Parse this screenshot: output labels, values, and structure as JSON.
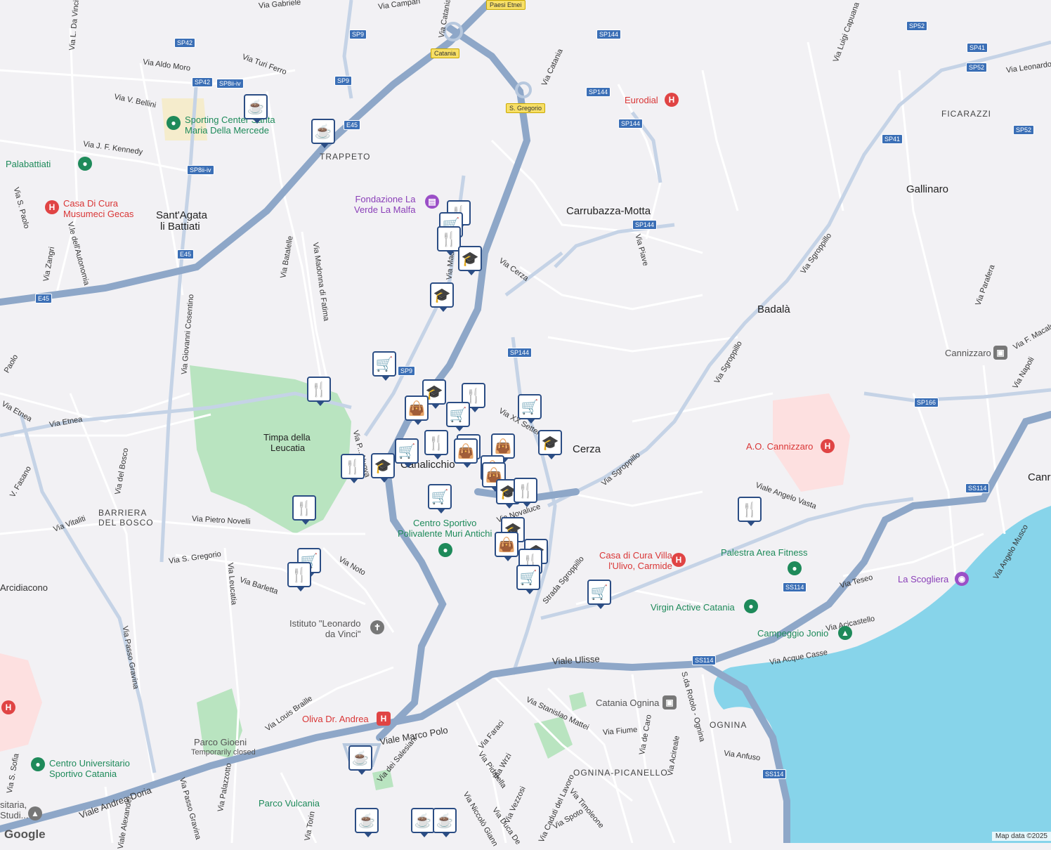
{
  "colors": {
    "background": "#f2f1f4",
    "sea": "#87d4ea",
    "park": "#b9e4c0",
    "hospital_area": "#fde0e0",
    "highway": "#8ea7c8",
    "marker_border": "#2b4d84"
  },
  "areas": [
    {
      "id": "trappeto",
      "text": "TRAPPETO",
      "kind": "dist"
    },
    {
      "id": "sant-agata",
      "text": "Sant'Agata",
      "kind": "area"
    },
    {
      "id": "li-battiati",
      "text": "li Battiati",
      "kind": "area"
    },
    {
      "id": "carrubazza",
      "text": "Carrubazza-Motta",
      "kind": "area"
    },
    {
      "id": "gallinaro",
      "text": "Gallinaro",
      "kind": "area"
    },
    {
      "id": "ficarazzi",
      "text": "FICARAZZI",
      "kind": "dist"
    },
    {
      "id": "badala",
      "text": "Badalà",
      "kind": "area"
    },
    {
      "id": "cerza",
      "text": "Cerza",
      "kind": "area"
    },
    {
      "id": "canalicchio",
      "text": "Canalicchio",
      "kind": "area"
    },
    {
      "id": "barriera",
      "text": "BARRIERA",
      "kind": "dist"
    },
    {
      "id": "del-bosco",
      "text": "DEL BOSCO",
      "kind": "dist"
    },
    {
      "id": "ognina",
      "text": "OGNINA",
      "kind": "dist"
    },
    {
      "id": "ognina-picanello",
      "text": "OGNINA-PICANELLO",
      "kind": "dist"
    },
    {
      "id": "timpa",
      "text": "Timpa della",
      "kind": "area-sm"
    },
    {
      "id": "leucatia",
      "text": "Leucatia",
      "kind": "area-sm"
    },
    {
      "id": "canr",
      "text": "Canr",
      "kind": "area"
    }
  ],
  "roads": [
    {
      "id": "via-aldo-moro",
      "text": "Via Aldo Moro"
    },
    {
      "id": "via-turi-ferro",
      "text": "Via Turi Ferro"
    },
    {
      "id": "via-v-bellini",
      "text": "Via V. Bellini"
    },
    {
      "id": "via-j-f-kennedy",
      "text": "Via J. F. Kennedy"
    },
    {
      "id": "via-l-da-vinci",
      "text": "Via L. Da Vinci"
    },
    {
      "id": "via-catania-1",
      "text": "Via Catania"
    },
    {
      "id": "via-catania-2",
      "text": "Via Catania"
    },
    {
      "id": "via-gabriele",
      "text": "Via Gabriele"
    },
    {
      "id": "via-campanella",
      "text": "Via Campan"
    },
    {
      "id": "via-cerza",
      "text": "Via Cerza"
    },
    {
      "id": "via-piave",
      "text": "Via Piave"
    },
    {
      "id": "via-sgroppillo-1",
      "text": "Via Sgroppillo"
    },
    {
      "id": "via-sgroppillo-2",
      "text": "Via Sgroppillo"
    },
    {
      "id": "via-sgroppillo-3",
      "text": "Via Sgroppillo"
    },
    {
      "id": "strada-sgroppillo",
      "text": "Strada Sgroppillo"
    },
    {
      "id": "via-luigi-capuana",
      "text": "Via Luigi Capuana"
    },
    {
      "id": "via-leonardo",
      "text": "Via Leonardo"
    },
    {
      "id": "via-parafera",
      "text": "Via Parafera"
    },
    {
      "id": "via-f-macaluso",
      "text": "Via F. Macaluso"
    },
    {
      "id": "via-napoli",
      "text": "Via Napoli"
    },
    {
      "id": "via-batalelle",
      "text": "Via Batalelle"
    },
    {
      "id": "via-madonna-fatima",
      "text": "Via Madonna di Fatima"
    },
    {
      "id": "via-giovanni-cosentino",
      "text": "Via Giovanni Cosentino"
    },
    {
      "id": "via-s-paolo",
      "text": "Via S. Paolo"
    },
    {
      "id": "via-paolo",
      "text": "Paolo"
    },
    {
      "id": "via-zangri",
      "text": "Via Zangri"
    },
    {
      "id": "via-autonomia",
      "text": "V.le dell'Autonomia"
    },
    {
      "id": "via-etnea-1",
      "text": "Via Etnea"
    },
    {
      "id": "via-etnea-2",
      "text": "Via Etnea"
    },
    {
      "id": "v-fasano",
      "text": "V. Fasano"
    },
    {
      "id": "via-del-bosco",
      "text": "Via del Bosco"
    },
    {
      "id": "via-vitaliti",
      "text": "Via Vitaliti"
    },
    {
      "id": "via-pietro-novelli",
      "text": "Via Pietro Novelli"
    },
    {
      "id": "via-s-gregorio",
      "text": "Via S. Gregorio"
    },
    {
      "id": "via-leucatia",
      "text": "Via Leucatia"
    },
    {
      "id": "via-barletta",
      "text": "Via Barletta"
    },
    {
      "id": "via-noto",
      "text": "Via Noto"
    },
    {
      "id": "via-xx-settembre",
      "text": "Via XX Settembre"
    },
    {
      "id": "via-novaluce",
      "text": "Via Novaluce"
    },
    {
      "id": "viale-angelo-vasta",
      "text": "Viale Angelo Vasta"
    },
    {
      "id": "via-teseo",
      "text": "Via Teseo"
    },
    {
      "id": "via-acicastello",
      "text": "Via Acicastello"
    },
    {
      "id": "via-acque-casse",
      "text": "Via Acque Casse"
    },
    {
      "id": "via-angelo-musco",
      "text": "Via Angelo Musco"
    },
    {
      "id": "viale-ulisse",
      "text": "Viale Ulisse"
    },
    {
      "id": "via-passo-gravina",
      "text": "Via Passo Gravina"
    },
    {
      "id": "via-louis-braille",
      "text": "Via Louis Braille"
    },
    {
      "id": "viale-marco-polo",
      "text": "Viale Marco Polo"
    },
    {
      "id": "via-stanislao-mattei",
      "text": "Via Stanislao Mattei"
    },
    {
      "id": "via-fiume",
      "text": "Via Fiume"
    },
    {
      "id": "via-de-caro",
      "text": "Via de Caro"
    },
    {
      "id": "via-rotolo",
      "text": "S.da Rotolo - Ognina"
    },
    {
      "id": "via-acireale",
      "text": "Via Acireale"
    },
    {
      "id": "via-anfuso",
      "text": "Via Anfuso"
    },
    {
      "id": "via-faraci",
      "text": "Via Faraci"
    },
    {
      "id": "via-wrzi",
      "text": "Via Wrzi"
    },
    {
      "id": "via-pidatella",
      "text": "Via Pidatella"
    },
    {
      "id": "via-salesiani",
      "text": "Via dei Salesiani"
    },
    {
      "id": "via-vezzosi",
      "text": "Via Vezzosi"
    },
    {
      "id": "via-caduti-lavoro",
      "text": "Via Caduti del Lavoro"
    },
    {
      "id": "via-timoleone",
      "text": "Via Timoleone"
    },
    {
      "id": "via-spoto",
      "text": "Via Spoto"
    },
    {
      "id": "via-niccolo",
      "text": "Via Niccolò Giann"
    },
    {
      "id": "via-duca",
      "text": "Via Duca De"
    },
    {
      "id": "viale-andrea-doria",
      "text": "Viale Andrea Doria"
    },
    {
      "id": "viale-alexander",
      "text": "Viale Alexander"
    },
    {
      "id": "via-passo-gravina-2",
      "text": "Via Passo Gravina"
    },
    {
      "id": "via-palazzotto",
      "text": "Via Palazzotto"
    },
    {
      "id": "via-torino",
      "text": "Via Torin"
    },
    {
      "id": "via-s-sofia",
      "text": "Via S. Sofia"
    },
    {
      "id": "via-arcidiacono",
      "text": "Arcidiacono"
    },
    {
      "id": "via-madonna",
      "text": "Via Madonna"
    },
    {
      "id": "via-p-nuova",
      "text": "Via P... Nuova"
    }
  ],
  "shields": [
    {
      "id": "sp9-1",
      "text": "SP9"
    },
    {
      "id": "sp9-2",
      "text": "SP9"
    },
    {
      "id": "sp9-3",
      "text": "SP9"
    },
    {
      "id": "sp42-1",
      "text": "SP42"
    },
    {
      "id": "sp42-2",
      "text": "SP42"
    },
    {
      "id": "sp8-1",
      "text": "SP8ii-iv"
    },
    {
      "id": "sp8-2",
      "text": "SP8ii-iv"
    },
    {
      "id": "e45-1",
      "text": "E45"
    },
    {
      "id": "e45-2",
      "text": "E45"
    },
    {
      "id": "e45-3",
      "text": "E45"
    },
    {
      "id": "sp144-1",
      "text": "SP144"
    },
    {
      "id": "sp144-2",
      "text": "SP144"
    },
    {
      "id": "sp144-3",
      "text": "SP144"
    },
    {
      "id": "sp144-4",
      "text": "SP144"
    },
    {
      "id": "sp144-5",
      "text": "SP144"
    },
    {
      "id": "sp52-1",
      "text": "SP52"
    },
    {
      "id": "sp52-2",
      "text": "SP52"
    },
    {
      "id": "sp52-3",
      "text": "SP52"
    },
    {
      "id": "sp41-1",
      "text": "SP41"
    },
    {
      "id": "sp41-2",
      "text": "SP41"
    },
    {
      "id": "sp166",
      "text": "SP166"
    },
    {
      "id": "ss114-1",
      "text": "SS114"
    },
    {
      "id": "ss114-2",
      "text": "SS114"
    },
    {
      "id": "ss114-3",
      "text": "SS114"
    },
    {
      "id": "ss114-4",
      "text": "SS114"
    }
  ],
  "yellow_shields": [
    {
      "id": "catania",
      "text": "Catania"
    },
    {
      "id": "s-gregorio",
      "text": "S. Gregorio"
    },
    {
      "id": "paesi-etnei",
      "text": "Paesi Etnei"
    }
  ],
  "pois": [
    {
      "id": "sporting",
      "line1": "Sporting Center Santa",
      "line2": "Maria Della Mercede",
      "color": "green",
      "icon": "●"
    },
    {
      "id": "palabattiati",
      "line1": "Palabattiati",
      "line2": "",
      "color": "green",
      "icon": "●"
    },
    {
      "id": "musumeci",
      "line1": "Casa Di Cura",
      "line2": "Musumeci Gecas",
      "color": "red",
      "icon": "H"
    },
    {
      "id": "fondazione",
      "line1": "Fondazione La",
      "line2": "Verde La Malfa",
      "color": "purple",
      "icon": "▤"
    },
    {
      "id": "eurodial",
      "line1": "Eurodial",
      "line2": "",
      "color": "red",
      "icon": "H"
    },
    {
      "id": "cannizzaro-station",
      "line1": "Cannizzaro",
      "line2": "",
      "color": "grey",
      "icon": "▣"
    },
    {
      "id": "ao-cannizzaro",
      "line1": "A.O. Cannizzaro",
      "line2": "",
      "color": "red",
      "icon": "H"
    },
    {
      "id": "centro-sportivo",
      "line1": "Centro Sportivo",
      "line2": "Polivalente Muri Antichi",
      "color": "green",
      "icon": "●"
    },
    {
      "id": "villa-ulivo",
      "line1": "Casa di Cura Villa",
      "line2": "l'Ulivo, Carmide",
      "color": "red",
      "icon": "H"
    },
    {
      "id": "palestra",
      "line1": "Palestra Area Fitness",
      "line2": "",
      "color": "green",
      "icon": "●"
    },
    {
      "id": "la-scogliera",
      "line1": "La Scogliera",
      "line2": "",
      "color": "purple",
      "icon": "◉"
    },
    {
      "id": "virgin",
      "line1": "Virgin Active Catania",
      "line2": "",
      "color": "green",
      "icon": "●"
    },
    {
      "id": "campeggio",
      "line1": "Campeggio Jonio",
      "line2": "",
      "color": "green",
      "icon": "▲"
    },
    {
      "id": "istituto",
      "line1": "Istituto \"Leonardo",
      "line2": "da Vinci\"",
      "color": "grey",
      "icon": "✝"
    },
    {
      "id": "ognina-station",
      "line1": "Catania Ognina",
      "line2": "",
      "color": "grey",
      "icon": "▣"
    },
    {
      "id": "oliva",
      "line1": "Oliva Dr. Andrea",
      "line2": "",
      "color": "red",
      "icon": "H"
    },
    {
      "id": "parco-gioeni",
      "line1": "Parco Gioeni",
      "line2": "",
      "color": "grey",
      "icon": ""
    },
    {
      "id": "cus",
      "line1": "Centro Universitario",
      "line2": "Sportivo Catania",
      "color": "green",
      "icon": "●"
    },
    {
      "id": "parco-vulcania",
      "line1": "Parco Vulcania",
      "line2": "",
      "color": "green",
      "icon": ""
    },
    {
      "id": "universita",
      "line1": "sitaria,",
      "line2": "Studi...",
      "color": "grey",
      "icon": "▲"
    },
    {
      "id": "hospital-left",
      "line1": "",
      "line2": "",
      "color": "red",
      "icon": "H"
    }
  ],
  "parco_gioeni_note": "Temporarily closed",
  "markers": [
    {
      "id": "m1",
      "icon": "cafe"
    },
    {
      "id": "m2",
      "icon": "cafe"
    },
    {
      "id": "m3",
      "icon": "restaurant"
    },
    {
      "id": "m4",
      "icon": "shopping"
    },
    {
      "id": "m5",
      "icon": "restaurant"
    },
    {
      "id": "m6",
      "icon": "school"
    },
    {
      "id": "m7",
      "icon": "school"
    },
    {
      "id": "m8",
      "icon": "shopping"
    },
    {
      "id": "m9",
      "icon": "restaurant"
    },
    {
      "id": "m10",
      "icon": "school"
    },
    {
      "id": "m11",
      "icon": "restaurant"
    },
    {
      "id": "m12",
      "icon": "bag"
    },
    {
      "id": "m13",
      "icon": "shopping"
    },
    {
      "id": "m14",
      "icon": "shopping"
    },
    {
      "id": "m15",
      "icon": "school"
    },
    {
      "id": "m16",
      "icon": "shopping"
    },
    {
      "id": "m17",
      "icon": "restaurant"
    },
    {
      "id": "m18",
      "icon": "school"
    },
    {
      "id": "m19",
      "icon": "restaurant"
    },
    {
      "id": "m20",
      "icon": "restaurant"
    },
    {
      "id": "m21",
      "icon": "bag"
    },
    {
      "id": "m22",
      "icon": "bag"
    },
    {
      "id": "m23",
      "icon": "bag"
    },
    {
      "id": "m24",
      "icon": "bag"
    },
    {
      "id": "m25",
      "icon": "school"
    },
    {
      "id": "m26",
      "icon": "restaurant"
    },
    {
      "id": "m27",
      "icon": "shopping"
    },
    {
      "id": "m28",
      "icon": "restaurant"
    },
    {
      "id": "m29",
      "icon": "school"
    },
    {
      "id": "m30",
      "icon": "bag"
    },
    {
      "id": "m31",
      "icon": "school"
    },
    {
      "id": "m32",
      "icon": "restaurant"
    },
    {
      "id": "m33",
      "icon": "shopping"
    },
    {
      "id": "m34",
      "icon": "shopping"
    },
    {
      "id": "m35",
      "icon": "shopping"
    },
    {
      "id": "m36",
      "icon": "restaurant"
    },
    {
      "id": "m37",
      "icon": "restaurant"
    },
    {
      "id": "m38",
      "icon": "cafe"
    },
    {
      "id": "m39",
      "icon": "cafe"
    },
    {
      "id": "m40",
      "icon": "cafe"
    },
    {
      "id": "m41",
      "icon": "cafe"
    }
  ],
  "icon_glyphs": {
    "cafe": "☕",
    "restaurant": "🍴",
    "shopping": "🛒",
    "school": "🎓",
    "bag": "👜"
  },
  "footer": {
    "logo": "Google",
    "attribution": "Map data ©2025"
  }
}
